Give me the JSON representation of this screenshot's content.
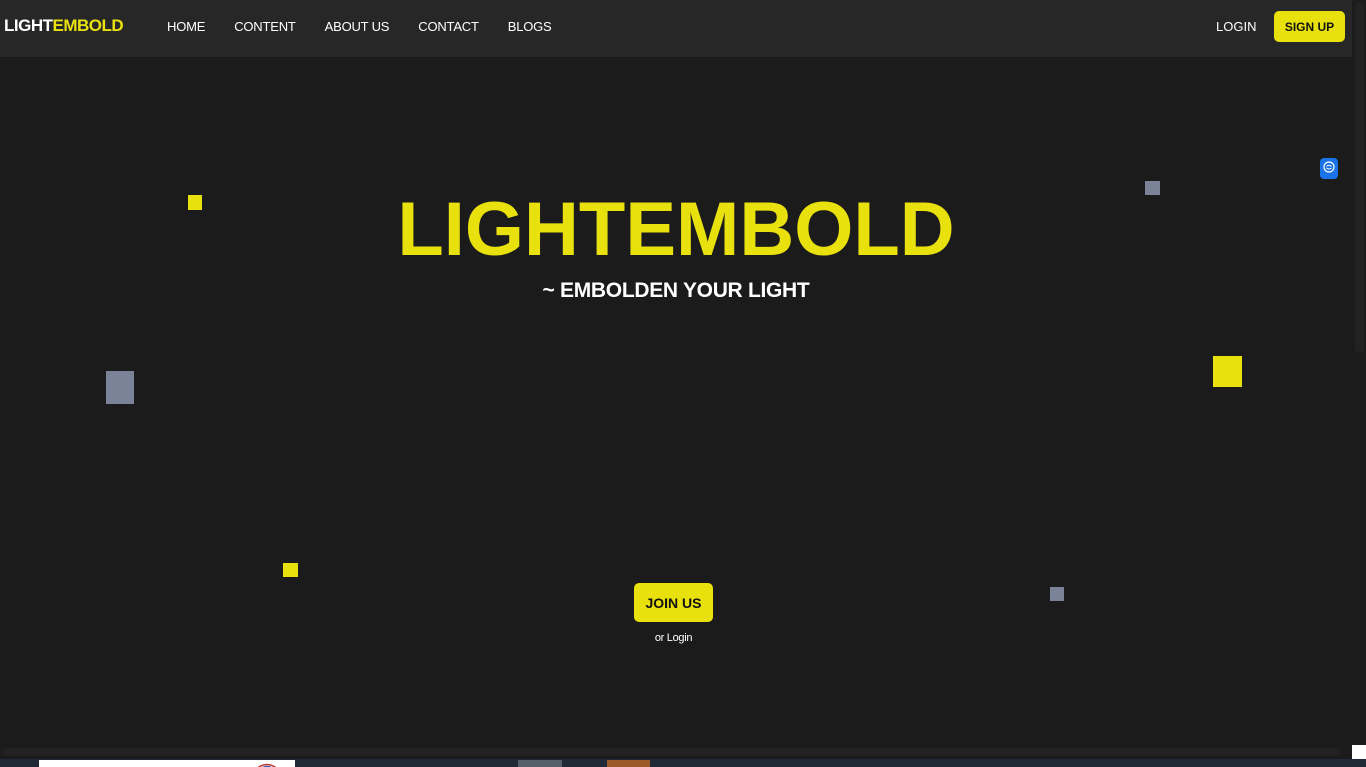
{
  "header": {
    "logo_part1": "LIGHT",
    "logo_part2": "EMBOLD",
    "nav": [
      {
        "label": "HOME"
      },
      {
        "label": "CONTENT"
      },
      {
        "label": "ABOUT US"
      },
      {
        "label": "CONTACT"
      },
      {
        "label": "BLOGS"
      }
    ],
    "login_label": "LOGIN",
    "signup_label": "SIGN UP"
  },
  "hero": {
    "title": "LIGHTEMBOLD",
    "subtitle": "~ EMBOLDEN YOUR LIGHT",
    "join_label": "JOIN US",
    "or_login": "or Login"
  },
  "colors": {
    "background": "#1b1b1b",
    "header_bg": "#272727",
    "accent": "#e8e10e",
    "square_grey": "#7a8398"
  },
  "icons": {
    "floating_widget": "brain-icon"
  }
}
